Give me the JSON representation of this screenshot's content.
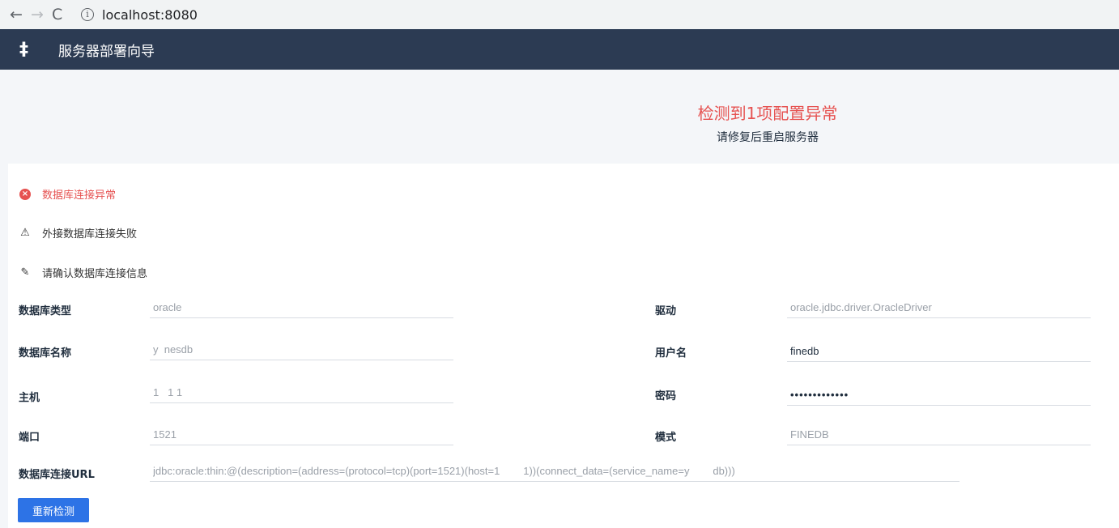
{
  "browser": {
    "back_icon": "←",
    "forward_icon": "→",
    "reload_icon": "C",
    "info_icon": "i",
    "url": "localhost:8080"
  },
  "header": {
    "logo_icon": "‡",
    "title": "服务器部署向导"
  },
  "banner": {
    "title": "检测到1项配置异常",
    "subtitle": "请修复后重启服务器"
  },
  "issue": {
    "error_icon": "×",
    "error_title": "数据库连接异常",
    "cause_icon": "⚠",
    "cause_text": "外接数据库连接失败",
    "fix_icon": "✎",
    "fix_text": "请确认数据库连接信息"
  },
  "form": {
    "db_type_label": "数据库类型",
    "db_type_value": "oracle",
    "driver_label": "驱动",
    "driver_value": "oracle.jdbc.driver.OracleDriver",
    "db_name_label": "数据库名称",
    "db_name_value": "y  nesdb",
    "username_label": "用户名",
    "username_value": "finedb",
    "host_label": "主机",
    "host_value": "1   1 1",
    "password_label": "密码",
    "password_value": "•••••••••••••",
    "port_label": "端口",
    "port_value": "1521",
    "schema_label": "模式",
    "schema_value": "FINEDB",
    "url_label": "数据库连接URL",
    "url_value": "jdbc:oracle:thin:@(description=(address=(protocol=tcp)(port=1521)(host=1        1))(connect_data=(service_name=y        db)))"
  },
  "actions": {
    "recheck_label": "重新检测"
  },
  "colors": {
    "header_bg": "#2c3b53",
    "error": "#e65251",
    "primary": "#2d73e6"
  }
}
